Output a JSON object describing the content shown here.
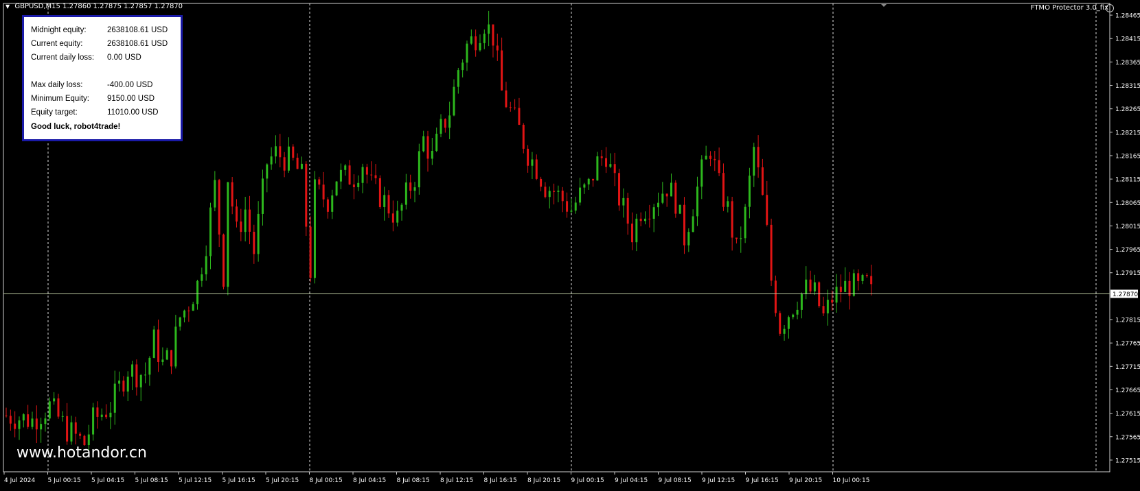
{
  "header": {
    "symbol": "GBPUSD,M15",
    "quote": "1.27860 1.27875 1.27857 1.27870"
  },
  "expert": {
    "label": "FTMO Protector 3.0_fix"
  },
  "panel": {
    "rows": [
      {
        "label": "Midnight equity:",
        "value": "2638108.61 USD"
      },
      {
        "label": "Current equity:",
        "value": "2638108.61 USD"
      },
      {
        "label": "Current daily loss:",
        "value": "0.00 USD"
      },
      {
        "label": "Max daily loss:",
        "value": "-400.00 USD"
      },
      {
        "label": "Minimum Equity:",
        "value": "9150.00 USD"
      },
      {
        "label": "Equity target:",
        "value": "11010.00 USD"
      }
    ],
    "footer": "Good luck, robot4trade!"
  },
  "watermark": "www.hotandor.cn",
  "colors": {
    "bull": "#2db81d",
    "bear": "#e11414",
    "background": "#000000",
    "grid": "#ffffff",
    "panel_border": "#1a1aa8"
  },
  "chart_data": {
    "type": "candlestick",
    "symbol": "GBPUSD",
    "timeframe": "M15",
    "current_price": "1.27870",
    "ylim": [
      1.2749,
      1.2849
    ],
    "price_ticks": [
      "1.28465",
      "1.28415",
      "1.28365",
      "1.28315",
      "1.28265",
      "1.28215",
      "1.28165",
      "1.28115",
      "1.28065",
      "1.28015",
      "1.27965",
      "1.27915",
      "1.27815",
      "1.27765",
      "1.27715",
      "1.27665",
      "1.27615",
      "1.27565",
      "1.27515"
    ],
    "time_ticks": [
      "4 Jul 2024",
      "5 Jul 00:15",
      "5 Jul 04:15",
      "5 Jul 08:15",
      "5 Jul 12:15",
      "5 Jul 16:15",
      "5 Jul 20:15",
      "8 Jul 00:15",
      "8 Jul 04:15",
      "8 Jul 08:15",
      "8 Jul 12:15",
      "8 Jul 16:15",
      "8 Jul 20:15",
      "9 Jul 00:15",
      "9 Jul 04:15",
      "9 Jul 08:15",
      "9 Jul 12:15",
      "9 Jul 16:15",
      "9 Jul 20:15",
      "10 Jul 00:15"
    ],
    "close_path": [
      [
        0,
        1.2761
      ],
      [
        6,
        1.276
      ],
      [
        10,
        1.2763
      ],
      [
        14,
        1.2758
      ],
      [
        18,
        1.2755
      ],
      [
        20,
        1.276
      ],
      [
        24,
        1.2763
      ],
      [
        28,
        1.2771
      ],
      [
        30,
        1.277
      ],
      [
        32,
        1.277
      ],
      [
        34,
        1.2777
      ],
      [
        36,
        1.2772
      ],
      [
        38,
        1.2774
      ],
      [
        40,
        1.2782
      ],
      [
        42,
        1.2785
      ],
      [
        44,
        1.2789
      ],
      [
        46,
        1.2798
      ],
      [
        48,
        1.281
      ],
      [
        50,
        1.2791
      ],
      [
        51,
        1.2812
      ],
      [
        53,
        1.28
      ],
      [
        55,
        1.2805
      ],
      [
        57,
        1.2796
      ],
      [
        60,
        1.2815
      ],
      [
        62,
        1.2817
      ],
      [
        64,
        1.2816
      ],
      [
        66,
        1.2815
      ],
      [
        68,
        1.2812
      ],
      [
        70,
        1.2792
      ],
      [
        71,
        1.2809
      ],
      [
        74,
        1.2807
      ],
      [
        76,
        1.2812
      ],
      [
        80,
        1.2812
      ],
      [
        82,
        1.2815
      ],
      [
        84,
        1.281
      ],
      [
        86,
        1.2808
      ],
      [
        90,
        1.2803
      ],
      [
        92,
        1.2808
      ],
      [
        94,
        1.2812
      ],
      [
        96,
        1.282
      ],
      [
        98,
        1.2816
      ],
      [
        100,
        1.2822
      ],
      [
        102,
        1.2826
      ],
      [
        104,
        1.2835
      ],
      [
        106,
        1.284
      ],
      [
        108,
        1.2842
      ],
      [
        110,
        1.2845
      ],
      [
        112,
        1.2842
      ],
      [
        114,
        1.283
      ],
      [
        116,
        1.2826
      ],
      [
        118,
        1.2822
      ],
      [
        120,
        1.2817
      ],
      [
        122,
        1.2814
      ],
      [
        124,
        1.281
      ],
      [
        126,
        1.2809
      ],
      [
        128,
        1.2807
      ],
      [
        130,
        1.2805
      ],
      [
        132,
        1.2808
      ],
      [
        134,
        1.281
      ],
      [
        136,
        1.2815
      ],
      [
        138,
        1.2817
      ],
      [
        140,
        1.281
      ],
      [
        142,
        1.2805
      ],
      [
        144,
        1.28
      ],
      [
        146,
        1.2805
      ],
      [
        148,
        1.2806
      ],
      [
        150,
        1.2808
      ],
      [
        152,
        1.281
      ],
      [
        154,
        1.2807
      ],
      [
        156,
        1.2799
      ],
      [
        158,
        1.2806
      ],
      [
        160,
        1.2813
      ],
      [
        162,
        1.2818
      ],
      [
        164,
        1.281
      ],
      [
        166,
        1.2805
      ],
      [
        168,
        1.2796
      ],
      [
        170,
        1.2804
      ],
      [
        172,
        1.2818
      ],
      [
        174,
        1.2807
      ],
      [
        175,
        1.28
      ],
      [
        176,
        1.279
      ],
      [
        178,
        1.278
      ],
      [
        180,
        1.2783
      ],
      [
        182,
        1.2786
      ],
      [
        184,
        1.2788
      ],
      [
        186,
        1.2787
      ],
      [
        188,
        1.2782
      ],
      [
        190,
        1.2786
      ],
      [
        192,
        1.2788
      ],
      [
        194,
        1.2789
      ],
      [
        196,
        1.2788
      ],
      [
        198,
        1.2789
      ],
      [
        199,
        1.2787
      ]
    ]
  }
}
